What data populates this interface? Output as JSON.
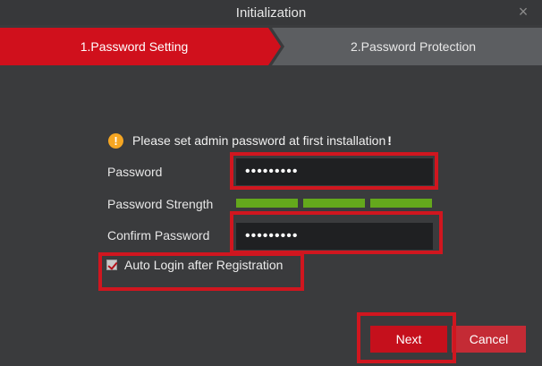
{
  "window": {
    "title": "Initialization",
    "close_icon": "close-icon"
  },
  "steps": [
    {
      "label": "1.Password Setting",
      "active": true,
      "color": "#d0101c"
    },
    {
      "label": "2.Password Protection",
      "active": false,
      "color": "#5c5e61"
    }
  ],
  "notice": {
    "icon": "warning-icon",
    "text": "Please set admin password at first installation",
    "emphasis": "!"
  },
  "form": {
    "password_label": "Password",
    "password_value": "•••••••••",
    "strength_label": "Password Strength",
    "strength_bars": [
      "strong",
      "strong",
      "strong"
    ],
    "strength_color": "#64a81c",
    "confirm_label": "Confirm Password",
    "confirm_value": "•••••••••",
    "auto_login_label": "Auto Login after Registration",
    "auto_login_checked": true
  },
  "buttons": {
    "next": "Next",
    "cancel": "Cancel"
  },
  "colors": {
    "accent": "#d0101c",
    "background": "#3a3b3d",
    "highlight": "#d0161f"
  }
}
